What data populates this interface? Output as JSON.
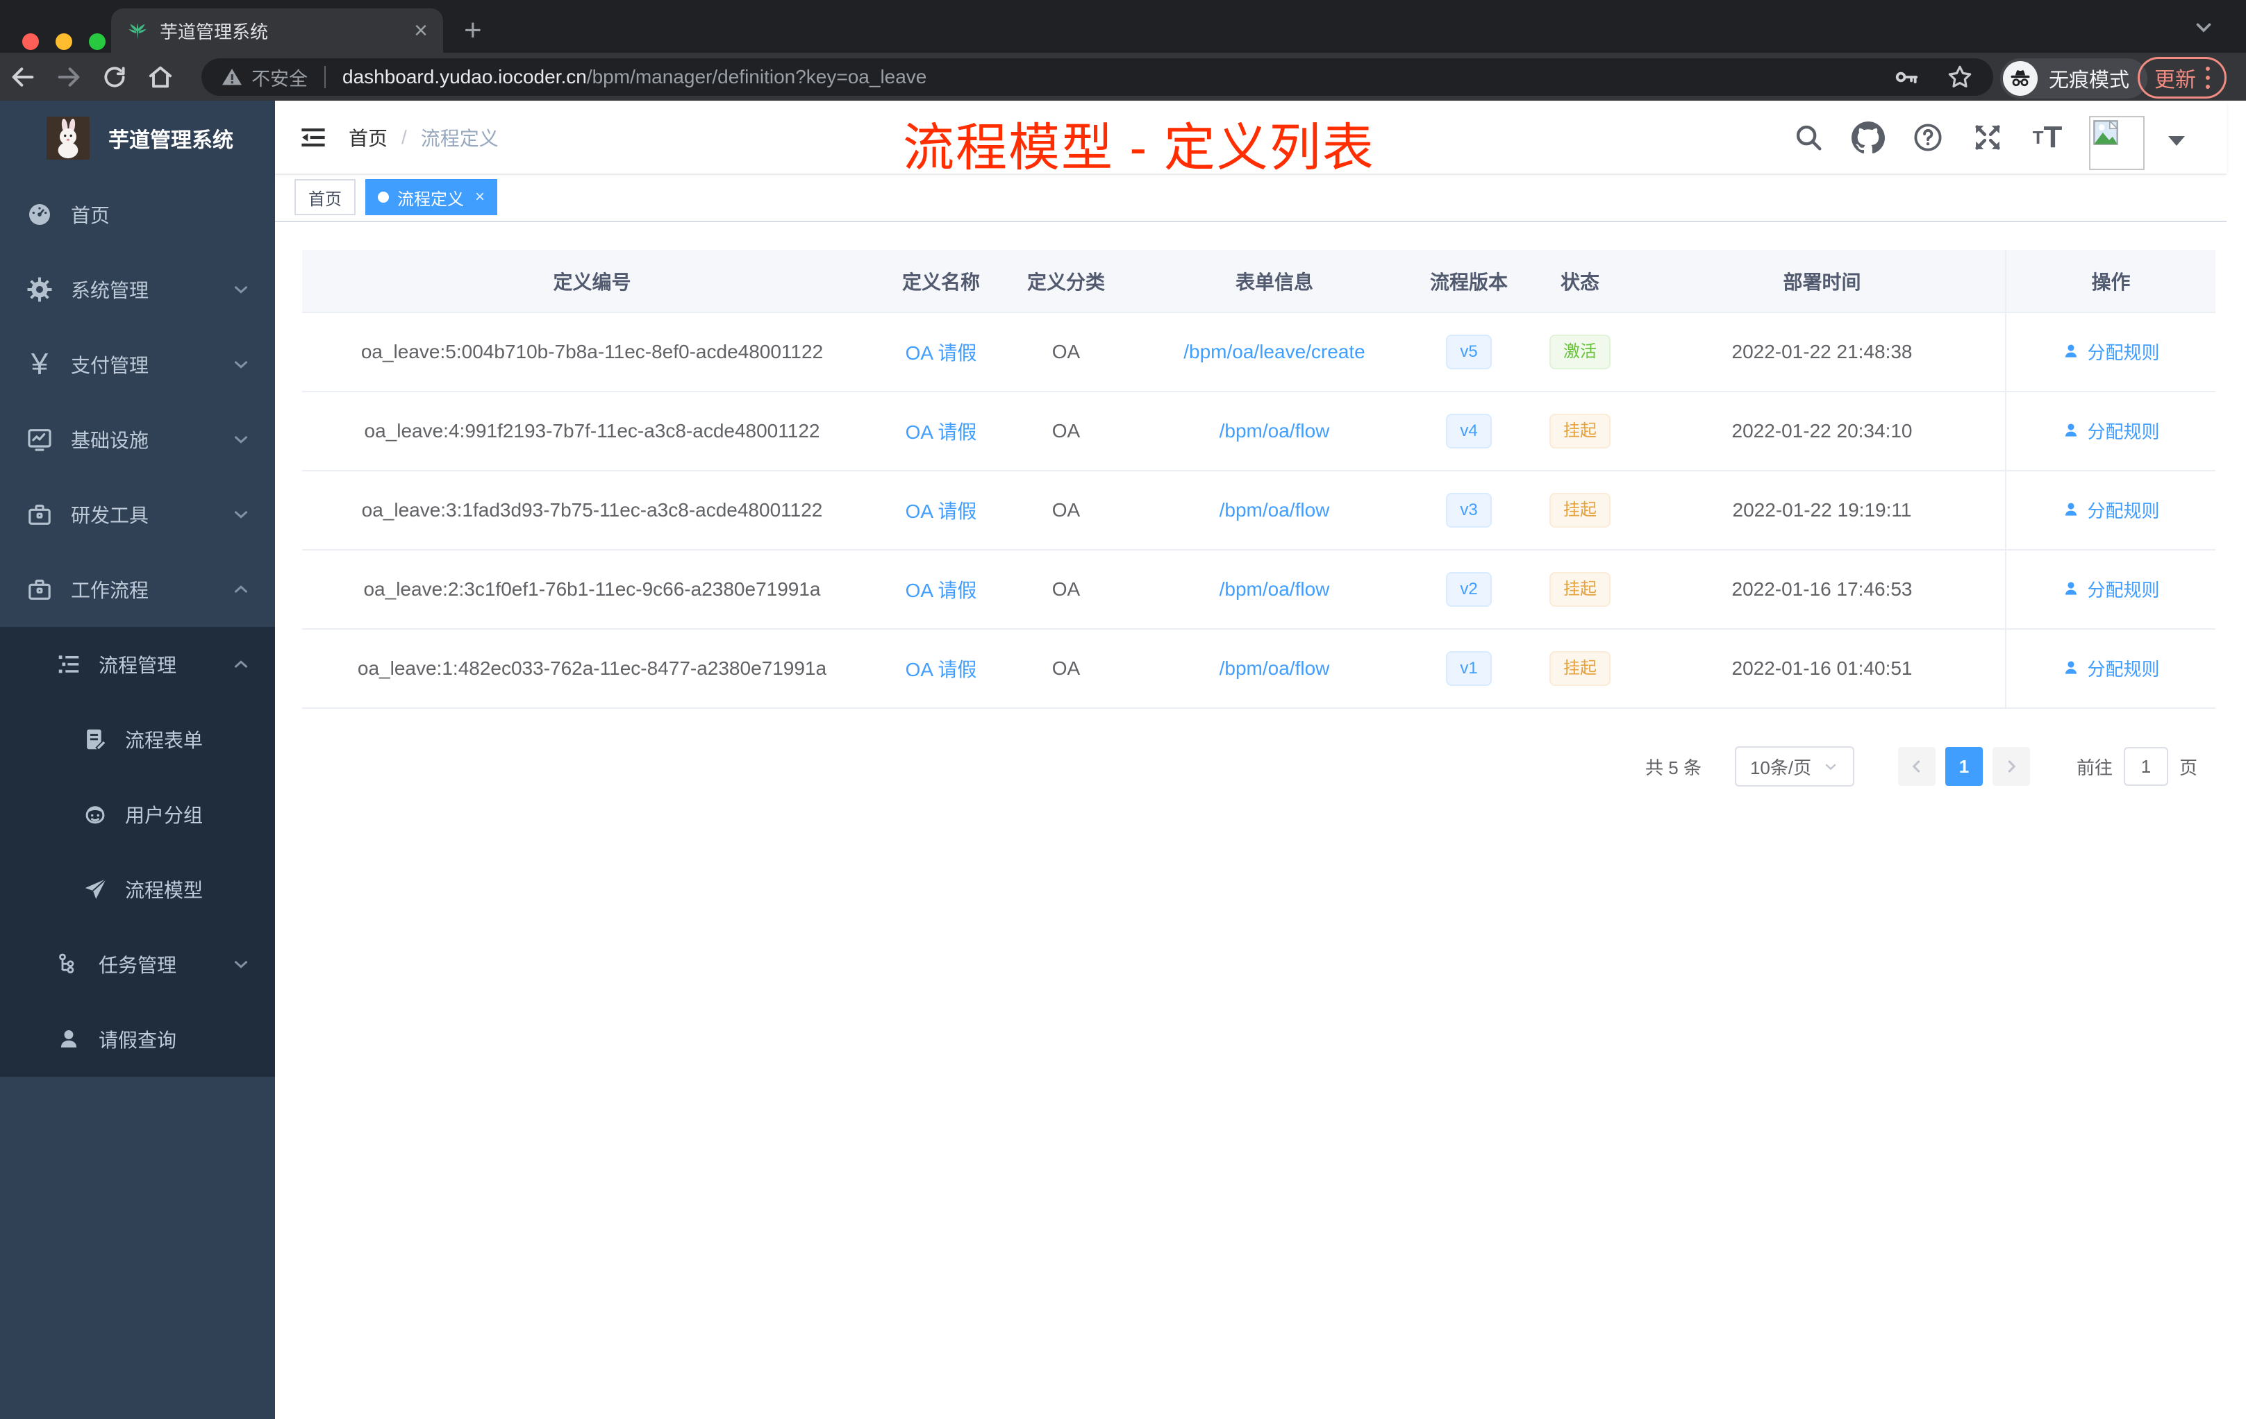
{
  "browser": {
    "tab_title": "芋道管理系统",
    "security": "不安全",
    "domain": "dashboard.yudao.iocoder.cn",
    "path": "/bpm/manager/definition?key=oa_leave",
    "incognito": "无痕模式",
    "update": "更新"
  },
  "sidebar": {
    "title": "芋道管理系统",
    "items": [
      {
        "label": "首页",
        "level": 1,
        "icon": "dashboard-icon"
      },
      {
        "label": "系统管理",
        "level": 1,
        "icon": "gear-icon",
        "chevron": "down"
      },
      {
        "label": "支付管理",
        "level": 1,
        "icon": "yen-icon",
        "chevron": "down"
      },
      {
        "label": "基础设施",
        "level": 1,
        "icon": "monitor-icon",
        "chevron": "down"
      },
      {
        "label": "研发工具",
        "level": 1,
        "icon": "toolbox-icon",
        "chevron": "down"
      },
      {
        "label": "工作流程",
        "level": 1,
        "icon": "briefcase-icon",
        "chevron": "up"
      },
      {
        "label": "流程管理",
        "level": 2,
        "icon": "tree-table-icon",
        "chevron": "up"
      },
      {
        "label": "流程表单",
        "level": 3,
        "icon": "form-doc-icon"
      },
      {
        "label": "用户分组",
        "level": 3,
        "icon": "robot-icon"
      },
      {
        "label": "流程模型",
        "level": 3,
        "icon": "paper-plane-icon"
      },
      {
        "label": "任务管理",
        "level": 2,
        "icon": "org-tree-icon",
        "chevron": "down"
      },
      {
        "label": "请假查询",
        "level": 2,
        "icon": "user-icon"
      }
    ]
  },
  "navbar": {
    "breadcrumb": {
      "home": "首页",
      "sep": "/",
      "current": "流程定义"
    },
    "annotation": "流程模型 - 定义列表"
  },
  "tags": {
    "home": "首页",
    "active": "流程定义"
  },
  "table": {
    "columns": [
      "定义编号",
      "定义名称",
      "定义分类",
      "表单信息",
      "流程版本",
      "状态",
      "部署时间",
      "操作"
    ],
    "action_label": "分配规则",
    "rows": [
      {
        "id": "oa_leave:5:004b710b-7b8a-11ec-8ef0-acde48001122",
        "name": "OA 请假",
        "category": "OA",
        "form": "/bpm/oa/leave/create",
        "version": "v5",
        "status": "激活",
        "status_type": "success",
        "time": "2022-01-22 21:48:38"
      },
      {
        "id": "oa_leave:4:991f2193-7b7f-11ec-a3c8-acde48001122",
        "name": "OA 请假",
        "category": "OA",
        "form": "/bpm/oa/flow",
        "version": "v4",
        "status": "挂起",
        "status_type": "warning",
        "time": "2022-01-22 20:34:10"
      },
      {
        "id": "oa_leave:3:1fad3d93-7b75-11ec-a3c8-acde48001122",
        "name": "OA 请假",
        "category": "OA",
        "form": "/bpm/oa/flow",
        "version": "v3",
        "status": "挂起",
        "status_type": "warning",
        "time": "2022-01-22 19:19:11"
      },
      {
        "id": "oa_leave:2:3c1f0ef1-76b1-11ec-9c66-a2380e71991a",
        "name": "OA 请假",
        "category": "OA",
        "form": "/bpm/oa/flow",
        "version": "v2",
        "status": "挂起",
        "status_type": "warning",
        "time": "2022-01-16 17:46:53"
      },
      {
        "id": "oa_leave:1:482ec033-762a-11ec-8477-a2380e71991a",
        "name": "OA 请假",
        "category": "OA",
        "form": "/bpm/oa/flow",
        "version": "v1",
        "status": "挂起",
        "status_type": "warning",
        "time": "2022-01-16 01:40:51"
      }
    ]
  },
  "pagination": {
    "total": "共 5 条",
    "size": "10条/页",
    "page": "1",
    "goto": "前往",
    "goto_value": "1",
    "unit": "页"
  },
  "colors": {
    "accent": "#409eff",
    "success": "#67c23a",
    "warning": "#e6a23c",
    "annotation": "#ff2d00",
    "sidebar": "#304156",
    "submenu": "#1f2d3d"
  }
}
